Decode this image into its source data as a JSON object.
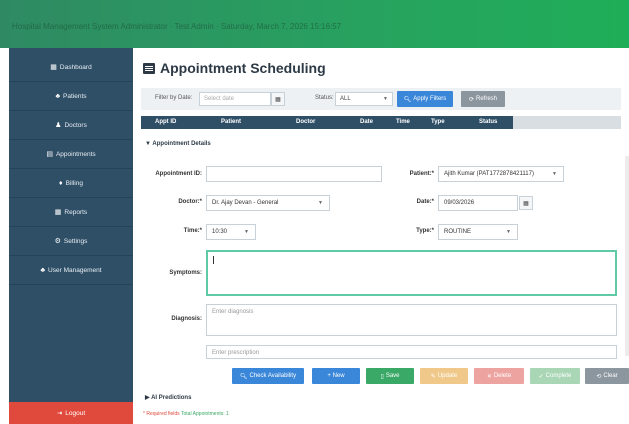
{
  "header": {
    "title": "Hospital Management System Administrator · Test Admin · Saturday, March 7, 2026 15:16:57"
  },
  "sidebar": {
    "items": [
      {
        "label": "Dashboard",
        "icon": "chart-icon"
      },
      {
        "label": "Patients",
        "icon": "users-icon"
      },
      {
        "label": "Doctors",
        "icon": "doctor-icon"
      },
      {
        "label": "Appointments",
        "icon": "calendar-icon"
      },
      {
        "label": "Billing",
        "icon": "money-icon"
      },
      {
        "label": "Reports",
        "icon": "chart-icon"
      },
      {
        "label": "Settings",
        "icon": "gear-icon"
      },
      {
        "label": "User Management",
        "icon": "users-icon"
      }
    ],
    "logout_label": "Logout"
  },
  "page": {
    "title": "Appointment Scheduling"
  },
  "filters": {
    "date_label": "Filter by Date:",
    "date_placeholder": "Select date",
    "status_label": "Status:",
    "status_value": "ALL",
    "apply_label": "Apply Filters",
    "refresh_label": "Refresh"
  },
  "table": {
    "columns": [
      "Appt ID",
      "Patient",
      "Doctor",
      "Date",
      "Time",
      "Type",
      "Status"
    ]
  },
  "form": {
    "section_title": "Appointment Details",
    "appointment_id_label": "Appointment ID:",
    "appointment_id_value": "",
    "patient_label": "Patient:*",
    "patient_value": "Ajith Kumar (PAT1772878421117)",
    "doctor_label": "Doctor:*",
    "doctor_value": "Dr. Ajay Devan - General",
    "date_label": "Date:*",
    "date_value": "09/03/2026",
    "time_label": "Time:*",
    "time_value": "10:30",
    "type_label": "Type:*",
    "type_value": "ROUTINE",
    "symptoms_label": "Symptoms:",
    "diagnosis_label": "Diagnosis:",
    "diagnosis_placeholder": "Enter diagnosis",
    "prescription_label": "Prescription:",
    "prescription_placeholder": "Enter prescription"
  },
  "actions": {
    "check_label": "Check Availability",
    "new_label": "+ New",
    "save_label": "Save",
    "update_label": "Update",
    "delete_label": "Delete",
    "complete_label": "Complete",
    "clear_label": "Clear"
  },
  "ai": {
    "label": "AI Predictions"
  },
  "footer": {
    "required_text": "* Required fields",
    "total_text": "Total Appointments: 1"
  },
  "colors": {
    "sidebar": "#2f4f67",
    "logout": "#e04a3c",
    "primary": "#3a86d8",
    "success": "#3aa866",
    "warning": "#f0c98a",
    "danger": "#eda3a0",
    "complete": "#a9d6b4",
    "neutral": "#8c969e"
  }
}
